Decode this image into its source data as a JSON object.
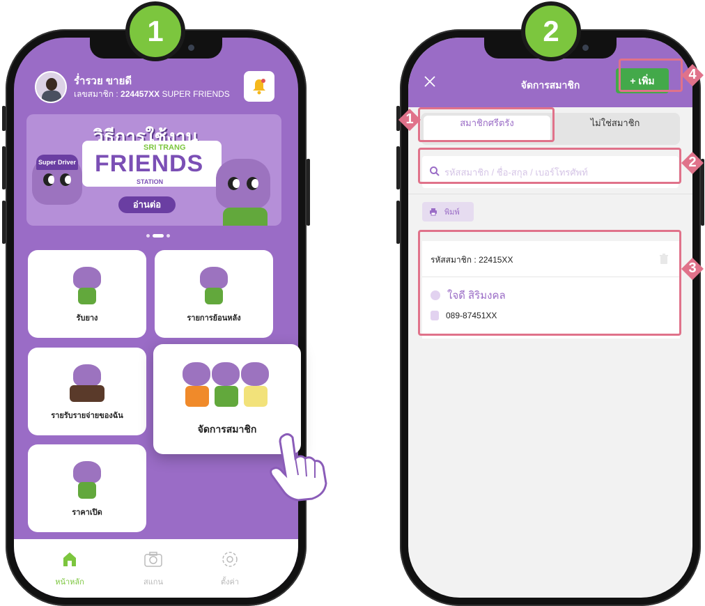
{
  "colors": {
    "purple": "#9a6cc6",
    "green": "#7cc63e",
    "callout": "#e0728a",
    "add_green": "#43a94a"
  },
  "steps": {
    "left": "1",
    "right": "2"
  },
  "screen1": {
    "user": {
      "name": "ร่ำรวย ขายดี",
      "member_label": "เลขสมาชิก : ",
      "member_id": "224457XX",
      "member_tier": " SUPER FRIENDS",
      "avatar_icon": "avatar-photo"
    },
    "notification_icon": "bell-icon",
    "banner": {
      "title": "วิธีการใช้งาน",
      "subtitle": "SRI TRANG",
      "brand": "FRIENDS",
      "station": "STATION",
      "cta": "อ่านต่อ",
      "badge": "Super Driver"
    },
    "menu": [
      {
        "label": "รับยาง"
      },
      {
        "label": "รายการย้อนหลัง"
      },
      {
        "label": "รายรับรายจ่ายของฉัน"
      },
      {
        "label": "จัดการสมาชิก"
      },
      {
        "label": "ราคาเปิด"
      }
    ],
    "counter_board_text": "FRIENDS",
    "bottom_nav": [
      {
        "label": "หน้าหลัก",
        "icon": "home-icon",
        "active": true
      },
      {
        "label": "สแกน",
        "icon": "camera-icon",
        "active": false
      },
      {
        "label": "ตั้งค่า",
        "icon": "gear-icon",
        "active": false
      }
    ]
  },
  "screen2": {
    "title": "จัดการสมาชิก",
    "add_button": "+ เพิ่ม",
    "tabs": [
      {
        "label": "สมาชิกศรีตรัง",
        "active": true
      },
      {
        "label": "ไม่ใช่สมาชิก",
        "active": false
      }
    ],
    "search": {
      "placeholder": "รหัสสมาชิก / ชื่อ-สกุล / เบอร์โทรศัพท์",
      "value": ""
    },
    "print_button": "พิมพ์",
    "member": {
      "code_label": "รหัสสมาชิก : 22415XX",
      "name": "ใจดี สิริมงคล",
      "phone": "089-87451XX"
    }
  },
  "callouts": [
    "1",
    "2",
    "3",
    "4"
  ]
}
